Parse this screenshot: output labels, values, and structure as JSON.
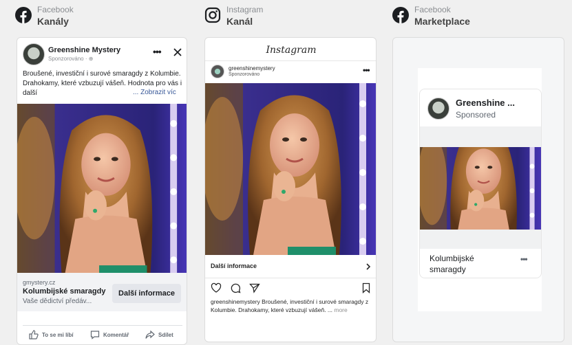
{
  "columns": [
    {
      "platform": "Facebook",
      "placement": "Kanály"
    },
    {
      "platform": "Instagram",
      "placement": "Kanál"
    },
    {
      "platform": "Facebook",
      "placement": "Marketplace"
    }
  ],
  "fb_feed": {
    "page_name": "Greenshine Mystery",
    "sponsored": "Sponzorováno · ",
    "primary_text": "Broušené, investiční i surové smaragdy z Kolumbie. Drahokamy, které vzbuzují vášeň. Hodnota pro vás i další",
    "see_more": "... Zobrazit víc",
    "link_domain": "gmystery.cz",
    "link_title": "Kolumbijské smaragdy",
    "link_description": "Vaše dědictví předáv...",
    "cta": "Další informace",
    "actions": [
      "To se mi líbí",
      "Komentář",
      "Sdílet"
    ]
  },
  "ig_feed": {
    "logo": "Instagram",
    "username": "greenshinemystery",
    "sponsored": "Sponzorováno",
    "cta": "Další informace",
    "caption_user": "greenshinemystery",
    "caption": " Broušené, investiční i surové smaragdy z Kolumbie. Drahokamy, které vzbuzují vášeň. ... ",
    "more": "more"
  },
  "marketplace": {
    "page_name": "Greenshine ...",
    "sponsored": "Sponsored",
    "title": "Kolumbijské smaragdy"
  },
  "colors": {
    "background": "#f0f0f0",
    "link_blue": "#385898",
    "photo_purple": "#3b2f8f"
  }
}
